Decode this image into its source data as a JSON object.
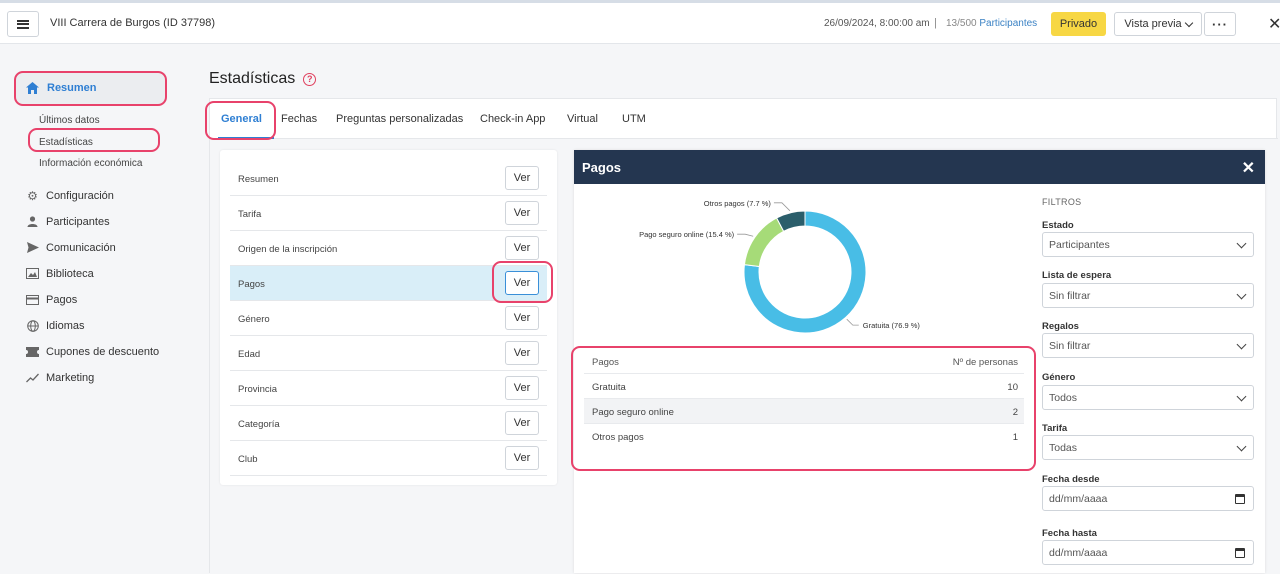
{
  "header": {
    "event_title": "VIII Carrera de Burgos (ID 37798)",
    "datetime": "26/09/2024, 8:00:00 am",
    "separator": "|",
    "count": "13/500",
    "participants_link": "Participantes",
    "private_label": "Privado",
    "preview_label": "Vista previa",
    "more_label": "···",
    "close_label": "✕"
  },
  "sidebar": {
    "resumen": "Resumen",
    "sub_items": [
      "Últimos datos",
      "Estadísticas",
      "Información económica"
    ],
    "items": [
      {
        "label": "Configuración",
        "icon": "gear-icon"
      },
      {
        "label": "Participantes",
        "icon": "person-icon"
      },
      {
        "label": "Comunicación",
        "icon": "send-icon"
      },
      {
        "label": "Biblioteca",
        "icon": "images-icon"
      },
      {
        "label": "Pagos",
        "icon": "card-icon"
      },
      {
        "label": "Idiomas",
        "icon": "globe-icon"
      },
      {
        "label": "Cupones de descuento",
        "icon": "ticket-icon"
      },
      {
        "label": "Marketing",
        "icon": "trend-icon"
      }
    ]
  },
  "page": {
    "title": "Estadísticas",
    "help": "?"
  },
  "tabs": [
    "General",
    "Fechas",
    "Preguntas personalizadas",
    "Check-in App",
    "Virtual",
    "UTM"
  ],
  "stats": {
    "button_label": "Ver",
    "rows": [
      "Resumen",
      "Tarifa",
      "Origen de la inscripción",
      "Pagos",
      "Género",
      "Edad",
      "Provincia",
      "Categoría",
      "Club"
    ],
    "selected": "Pagos"
  },
  "modal": {
    "title": "Pagos",
    "close": "✕",
    "table_headers": [
      "Pagos",
      "Nº de personas"
    ],
    "table_rows": [
      {
        "label": "Gratuita",
        "value": "10"
      },
      {
        "label": "Pago seguro online",
        "value": "2"
      },
      {
        "label": "Otros pagos",
        "value": "1"
      }
    ]
  },
  "chart_data": {
    "type": "pie",
    "donut": true,
    "slices": [
      {
        "label": "Gratuita",
        "value": 10,
        "percent_label": "Gratuita (76.9 %)",
        "color": "#48bde6"
      },
      {
        "label": "Pago seguro online",
        "value": 2,
        "percent_label": "Pago seguro online (15.4 %)",
        "color": "#a6db78"
      },
      {
        "label": "Otros pagos",
        "value": 1,
        "percent_label": "Otros pagos (7.7 %)",
        "color": "#2b5e6b"
      }
    ]
  },
  "filters": {
    "title": "FILTROS",
    "fields": [
      {
        "label": "Estado",
        "value": "Participantes",
        "type": "select"
      },
      {
        "label": "Lista de espera",
        "value": "Sin filtrar",
        "type": "select"
      },
      {
        "label": "Regalos",
        "value": "Sin filtrar",
        "type": "select"
      },
      {
        "label": "Género",
        "value": "Todos",
        "type": "select"
      },
      {
        "label": "Tarifa",
        "value": "Todas",
        "type": "select"
      },
      {
        "label": "Fecha desde",
        "value": "dd/mm/aaaa",
        "type": "date"
      },
      {
        "label": "Fecha hasta",
        "value": "dd/mm/aaaa",
        "type": "date"
      }
    ]
  },
  "colors": {
    "accent": "#2f7fd3",
    "highlight": "#e8426b",
    "modal_header": "#243650",
    "private": "#f7d744"
  }
}
